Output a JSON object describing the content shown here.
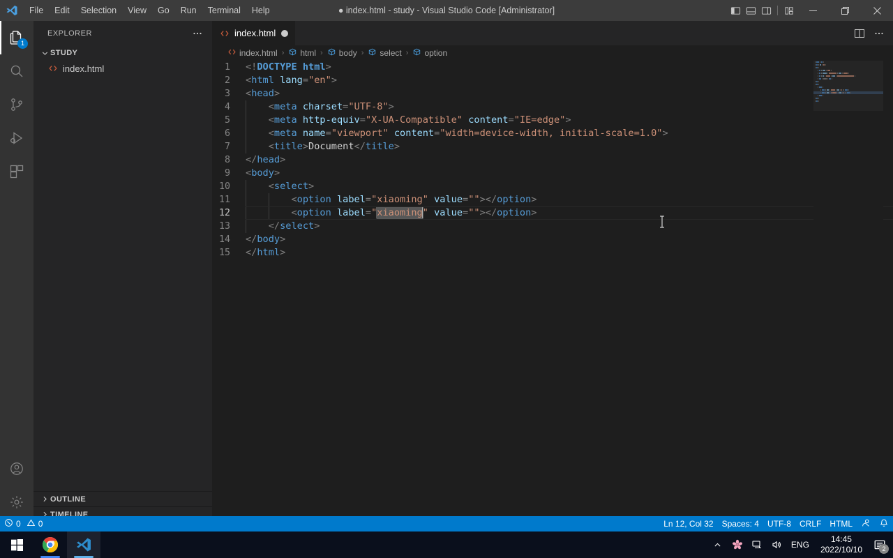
{
  "titlebar": {
    "title": "● index.html - study - Visual Studio Code [Administrator]",
    "logo_icon": "vscode-logo-icon",
    "menus": [
      "File",
      "Edit",
      "Selection",
      "View",
      "Go",
      "Run",
      "Terminal",
      "Help"
    ],
    "layout_buttons": [
      {
        "name": "toggle-primary-sidebar-icon"
      },
      {
        "name": "toggle-panel-icon"
      },
      {
        "name": "toggle-secondary-sidebar-icon"
      },
      {
        "name": "customize-layout-icon"
      }
    ],
    "window_buttons": [
      {
        "name": "minimize-button",
        "glyph": "—"
      },
      {
        "name": "maximize-restore-button",
        "glyph": "❐"
      },
      {
        "name": "close-button",
        "glyph": "✕"
      }
    ]
  },
  "activitybar": {
    "items": [
      {
        "name": "activity-explorer",
        "icon": "files-icon",
        "badge": "1",
        "active": true
      },
      {
        "name": "activity-search",
        "icon": "search-icon",
        "badge": "",
        "active": false
      },
      {
        "name": "activity-source-control",
        "icon": "source-control-icon",
        "badge": "",
        "active": false
      },
      {
        "name": "activity-run-debug",
        "icon": "run-and-debug-icon",
        "badge": "",
        "active": false
      },
      {
        "name": "activity-extensions",
        "icon": "extensions-icon",
        "badge": "",
        "active": false
      }
    ],
    "bottom": [
      {
        "name": "activity-accounts",
        "icon": "account-icon"
      },
      {
        "name": "activity-settings",
        "icon": "gear-icon"
      }
    ]
  },
  "sidebar": {
    "header_title": "EXPLORER",
    "more_actions_icon": "ellipsis-icon",
    "folder": {
      "name": "STUDY",
      "expanded": true,
      "chevron_icon": "chevron-down-icon"
    },
    "files": [
      {
        "name": "index.html",
        "icon": "html-file-icon"
      }
    ],
    "collapsed_panels": [
      {
        "label": "OUTLINE",
        "chevron_icon": "chevron-right-icon"
      },
      {
        "label": "TIMELINE",
        "chevron_icon": "chevron-right-icon"
      }
    ]
  },
  "editor": {
    "tabs": [
      {
        "label": "index.html",
        "icon": "html-file-icon",
        "dirty": true,
        "active": true
      }
    ],
    "tabbar_actions": [
      {
        "name": "split-editor-right-icon"
      },
      {
        "name": "more-editor-actions-icon"
      }
    ],
    "breadcrumbs": [
      {
        "label": "index.html",
        "icon": "html-file-icon"
      },
      {
        "label": "html",
        "icon": "symbol-field-icon"
      },
      {
        "label": "body",
        "icon": "symbol-field-icon"
      },
      {
        "label": "select",
        "icon": "symbol-field-icon"
      },
      {
        "label": "option",
        "icon": "symbol-field-icon"
      }
    ],
    "breadcrumb_separator": "›",
    "language": "HTML",
    "current_line_number": 12,
    "lines": [
      {
        "n": "1",
        "indent": 0,
        "tokens": [
          {
            "t": "punct",
            "v": "<!"
          },
          {
            "t": "doctype",
            "v": "DOCTYPE"
          },
          {
            "t": "text",
            "v": " "
          },
          {
            "t": "tagname-bold",
            "v": "html"
          },
          {
            "t": "punct",
            "v": ">"
          }
        ]
      },
      {
        "n": "2",
        "indent": 0,
        "tokens": [
          {
            "t": "punct",
            "v": "<"
          },
          {
            "t": "tag",
            "v": "html"
          },
          {
            "t": "text",
            "v": " "
          },
          {
            "t": "attr",
            "v": "lang"
          },
          {
            "t": "punct",
            "v": "="
          },
          {
            "t": "str",
            "v": "\"en\""
          },
          {
            "t": "punct",
            "v": ">"
          }
        ]
      },
      {
        "n": "3",
        "indent": 0,
        "tokens": [
          {
            "t": "punct",
            "v": "<"
          },
          {
            "t": "tag",
            "v": "head"
          },
          {
            "t": "punct",
            "v": ">"
          }
        ]
      },
      {
        "n": "4",
        "indent": 1,
        "tokens": [
          {
            "t": "punct",
            "v": "    <"
          },
          {
            "t": "tag",
            "v": "meta"
          },
          {
            "t": "text",
            "v": " "
          },
          {
            "t": "attr",
            "v": "charset"
          },
          {
            "t": "punct",
            "v": "="
          },
          {
            "t": "str",
            "v": "\"UTF-8\""
          },
          {
            "t": "punct",
            "v": ">"
          }
        ]
      },
      {
        "n": "5",
        "indent": 1,
        "tokens": [
          {
            "t": "punct",
            "v": "    <"
          },
          {
            "t": "tag",
            "v": "meta"
          },
          {
            "t": "text",
            "v": " "
          },
          {
            "t": "attr",
            "v": "http-equiv"
          },
          {
            "t": "punct",
            "v": "="
          },
          {
            "t": "str",
            "v": "\"X-UA-Compatible\""
          },
          {
            "t": "text",
            "v": " "
          },
          {
            "t": "attr",
            "v": "content"
          },
          {
            "t": "punct",
            "v": "="
          },
          {
            "t": "str",
            "v": "\"IE=edge\""
          },
          {
            "t": "punct",
            "v": ">"
          }
        ]
      },
      {
        "n": "6",
        "indent": 1,
        "tokens": [
          {
            "t": "punct",
            "v": "    <"
          },
          {
            "t": "tag",
            "v": "meta"
          },
          {
            "t": "text",
            "v": " "
          },
          {
            "t": "attr",
            "v": "name"
          },
          {
            "t": "punct",
            "v": "="
          },
          {
            "t": "str",
            "v": "\"viewport\""
          },
          {
            "t": "text",
            "v": " "
          },
          {
            "t": "attr",
            "v": "content"
          },
          {
            "t": "punct",
            "v": "="
          },
          {
            "t": "str",
            "v": "\"width=device-width, initial-scale=1.0\""
          },
          {
            "t": "punct",
            "v": ">"
          }
        ]
      },
      {
        "n": "7",
        "indent": 1,
        "tokens": [
          {
            "t": "punct",
            "v": "    <"
          },
          {
            "t": "tag",
            "v": "title"
          },
          {
            "t": "punct",
            "v": ">"
          },
          {
            "t": "text",
            "v": "Document"
          },
          {
            "t": "punct",
            "v": "</"
          },
          {
            "t": "tag",
            "v": "title"
          },
          {
            "t": "punct",
            "v": ">"
          }
        ]
      },
      {
        "n": "8",
        "indent": 0,
        "tokens": [
          {
            "t": "punct",
            "v": "</"
          },
          {
            "t": "tag",
            "v": "head"
          },
          {
            "t": "punct",
            "v": ">"
          }
        ]
      },
      {
        "n": "9",
        "indent": 0,
        "tokens": [
          {
            "t": "punct",
            "v": "<"
          },
          {
            "t": "tag",
            "v": "body"
          },
          {
            "t": "punct",
            "v": ">"
          }
        ]
      },
      {
        "n": "10",
        "indent": 1,
        "tokens": [
          {
            "t": "punct",
            "v": "    <"
          },
          {
            "t": "tag",
            "v": "select"
          },
          {
            "t": "punct",
            "v": ">"
          }
        ]
      },
      {
        "n": "11",
        "indent": 2,
        "tokens": [
          {
            "t": "punct",
            "v": "        <"
          },
          {
            "t": "tag",
            "v": "option"
          },
          {
            "t": "text",
            "v": " "
          },
          {
            "t": "attr",
            "v": "label"
          },
          {
            "t": "punct",
            "v": "="
          },
          {
            "t": "str",
            "v": "\"xiaoming\""
          },
          {
            "t": "text",
            "v": " "
          },
          {
            "t": "attr",
            "v": "value"
          },
          {
            "t": "punct",
            "v": "="
          },
          {
            "t": "str",
            "v": "\"\""
          },
          {
            "t": "punct",
            "v": "></"
          },
          {
            "t": "tag",
            "v": "option"
          },
          {
            "t": "punct",
            "v": ">"
          }
        ]
      },
      {
        "n": "12",
        "indent": 2,
        "current": true,
        "tokens": [
          {
            "t": "punct",
            "v": "        <"
          },
          {
            "t": "tag",
            "v": "option"
          },
          {
            "t": "text",
            "v": " "
          },
          {
            "t": "attr",
            "v": "label"
          },
          {
            "t": "punct",
            "v": "="
          },
          {
            "t": "str",
            "v": "\""
          },
          {
            "t": "str-hl",
            "v": "xiaoming"
          },
          {
            "t": "caret",
            "v": ""
          },
          {
            "t": "str",
            "v": "\""
          },
          {
            "t": "text",
            "v": " "
          },
          {
            "t": "attr",
            "v": "value"
          },
          {
            "t": "punct",
            "v": "="
          },
          {
            "t": "str",
            "v": "\"\""
          },
          {
            "t": "punct",
            "v": "></"
          },
          {
            "t": "tag",
            "v": "option"
          },
          {
            "t": "punct",
            "v": ">"
          }
        ]
      },
      {
        "n": "13",
        "indent": 1,
        "tokens": [
          {
            "t": "punct",
            "v": "    </"
          },
          {
            "t": "tag",
            "v": "select"
          },
          {
            "t": "punct",
            "v": ">"
          }
        ]
      },
      {
        "n": "14",
        "indent": 0,
        "tokens": [
          {
            "t": "punct",
            "v": "</"
          },
          {
            "t": "tag",
            "v": "body"
          },
          {
            "t": "punct",
            "v": ">"
          }
        ]
      },
      {
        "n": "15",
        "indent": 0,
        "tokens": [
          {
            "t": "punct",
            "v": "</"
          },
          {
            "t": "tag",
            "v": "html"
          },
          {
            "t": "punct",
            "v": ">"
          }
        ]
      }
    ]
  },
  "statusbar": {
    "left": [
      {
        "name": "status-problems",
        "icon": "error-icon",
        "errors": "0",
        "warn_icon": "warning-icon",
        "warnings": "0"
      }
    ],
    "right": [
      {
        "name": "status-cursor-position",
        "label": "Ln 12, Col 32"
      },
      {
        "name": "status-indentation",
        "label": "Spaces: 4"
      },
      {
        "name": "status-encoding",
        "label": "UTF-8"
      },
      {
        "name": "status-eol",
        "label": "CRLF"
      },
      {
        "name": "status-language-mode",
        "label": "HTML"
      },
      {
        "name": "status-feedback",
        "label": "",
        "icon": "feedback-smiley-icon"
      },
      {
        "name": "status-notifications",
        "label": "",
        "icon": "bell-icon"
      }
    ]
  },
  "taskbar": {
    "apps": [
      {
        "name": "start-button",
        "icon": "windows-logo-icon"
      },
      {
        "name": "taskbar-chrome",
        "icon": "chrome-icon",
        "active": false,
        "running": true
      },
      {
        "name": "taskbar-vscode",
        "icon": "vscode-icon",
        "active": true,
        "running": true
      }
    ],
    "tray": [
      {
        "name": "tray-show-hidden-icons",
        "icon": "chevron-up-icon"
      },
      {
        "name": "tray-sakura-app",
        "icon": "flower-icon"
      },
      {
        "name": "tray-network",
        "icon": "network-icon"
      },
      {
        "name": "tray-volume",
        "icon": "speaker-icon"
      }
    ],
    "language": "ENG",
    "time": "14:45",
    "date": "2022/10/10",
    "notifications_icon": "notification-icon",
    "notifications_count": "2"
  },
  "colors": {
    "accent": "#007acc",
    "titlebar_bg": "#3c3c3c",
    "sidebar_bg": "#252526",
    "editor_bg": "#1e1e1e",
    "activitybar_bg": "#333333",
    "tag": "#569cd6",
    "attr": "#9cdcfe",
    "string": "#ce9178",
    "punct": "#808080",
    "badge": "#007acc"
  }
}
